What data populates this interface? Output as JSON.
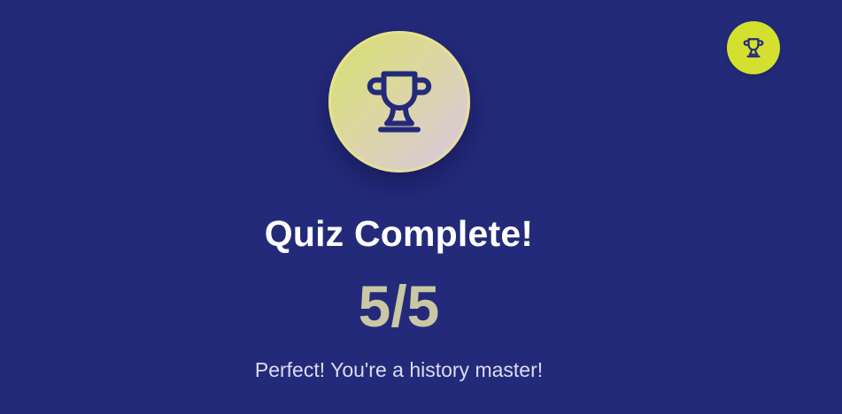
{
  "header": {
    "corner_icon": "trophy-icon",
    "corner_badge_color": "#d4e030"
  },
  "result": {
    "main_icon": "trophy-icon",
    "title": "Quiz Complete!",
    "score": "5/5",
    "message": "Perfect! You're a history master!"
  },
  "colors": {
    "background": "#242a7a",
    "title": "#ffffff",
    "score": "#cbc6a4",
    "message": "#dcdcf0",
    "icon_stroke": "#242a7a"
  }
}
